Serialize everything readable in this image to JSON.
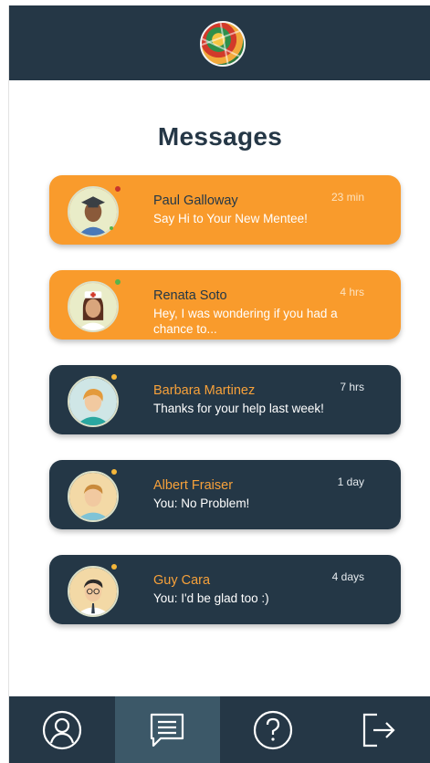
{
  "page": {
    "title": "Messages"
  },
  "colors": {
    "header": "#253746",
    "orange": "#f99b2c",
    "dark": "#243746",
    "active_tab": "#3c5868",
    "name_accent": "#f7a13a"
  },
  "messages": [
    {
      "name": "Paul Galloway",
      "text": "Say Hi to Your New Mentee!",
      "time": "23 min",
      "style": "orange",
      "avatar": "graduate-avatar"
    },
    {
      "name": "Renata Soto",
      "text": "Hey, I was wondering if you had a chance to...",
      "time": "4 hrs",
      "style": "orange",
      "avatar": "nurse-avatar"
    },
    {
      "name": "Barbara Martinez",
      "text": "Thanks for your help last week!",
      "time": "7 hrs",
      "style": "dark",
      "avatar": "woman-avatar"
    },
    {
      "name": "Albert Fraiser",
      "text": "You: No Problem!",
      "time": "1 day",
      "style": "dark",
      "avatar": "man-avatar"
    },
    {
      "name": "Guy Cara",
      "text": "You: I'd be glad too :)",
      "time": "4 days",
      "style": "dark",
      "avatar": "man-glasses-avatar"
    }
  ],
  "tabs": [
    {
      "icon": "profile-icon",
      "active": false
    },
    {
      "icon": "messages-icon",
      "active": true
    },
    {
      "icon": "help-icon",
      "active": false
    },
    {
      "icon": "logout-icon",
      "active": false
    }
  ]
}
